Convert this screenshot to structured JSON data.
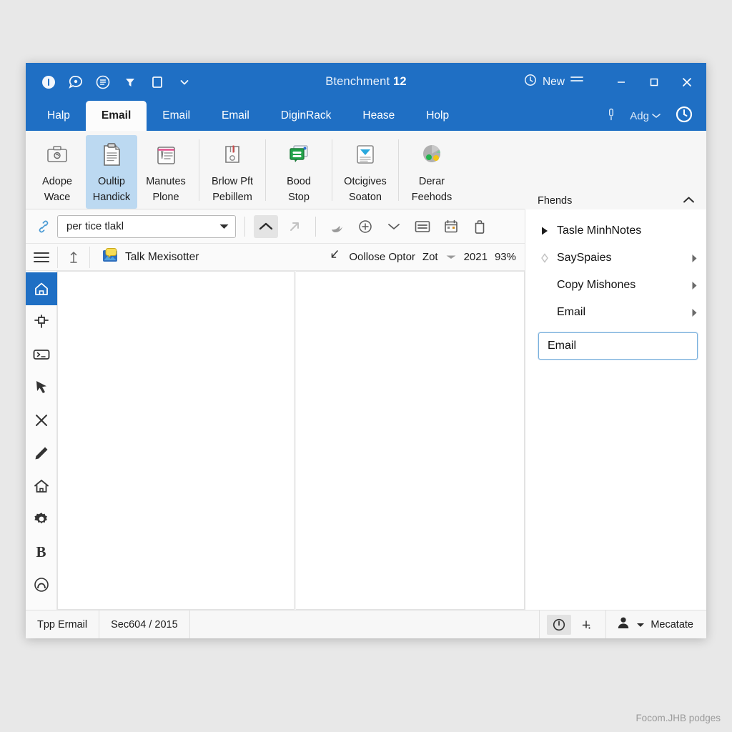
{
  "titlebar": {
    "quick_access": [
      "info-circle-icon",
      "chat-bubble-icon",
      "document-circle-icon",
      "funnel-icon",
      "square-icon",
      "chevron-down-icon"
    ],
    "title_prefix": "Btenchment ",
    "title_number": "12",
    "new_label": "New",
    "minimize_label": "—",
    "maximize_label": "☐",
    "close_label": "✕"
  },
  "tabs": [
    {
      "label": "Halp",
      "active": false
    },
    {
      "label": "Email",
      "active": true
    },
    {
      "label": "Email",
      "active": false
    },
    {
      "label": "Email",
      "active": false
    },
    {
      "label": "DiginRack",
      "active": false
    },
    {
      "label": "Hease",
      "active": false
    },
    {
      "label": "Holp",
      "active": false
    }
  ],
  "tabbar_right": {
    "account_label": "Adg"
  },
  "ribbon": {
    "buttons": [
      {
        "label": "Adope\nWace",
        "icon": "briefcase-icon",
        "selected": false
      },
      {
        "label": "Oultip\nHandick",
        "icon": "clipboard-icon",
        "selected": true
      },
      {
        "label": "Manutes\nPlone",
        "icon": "notepad-icon",
        "selected": false
      },
      {
        "label": "Brlow Pft\nPebillem",
        "icon": "pen-note-icon",
        "selected": false
      },
      {
        "label": "Bood\nStop",
        "icon": "window-stack-icon",
        "selected": false
      },
      {
        "label": "Otcigives\nSoaton",
        "icon": "download-doc-icon",
        "selected": false
      },
      {
        "label": "Derar\nFeehods",
        "icon": "pie-chart-icon",
        "selected": false
      }
    ]
  },
  "side_panel_header": {
    "title": "Fhends",
    "collapse_icon": "chevron-up-icon"
  },
  "toolbar": {
    "link_icon": "link-icon",
    "combo_value": "per tice tlakl",
    "combo_placeholder": "per tice tlakl",
    "collapse_button": "chevron-up-icon",
    "icons": [
      "arrow-up-right-icon",
      "bird-send-icon",
      "plus-circle-icon",
      "chevron-down-icon",
      "list-box-icon",
      "calendar-icon",
      "trash-icon"
    ]
  },
  "doc_header": {
    "menu_icon": "hamburger-icon",
    "anchor_icon": "anchor-icon",
    "doc_icon": "chat-image-icon",
    "doc_name": "Talk Mexisotter",
    "expand_icon": "expand-arrow-icon",
    "close_option": "Oollose Optor",
    "zoom_label": "Zot",
    "year": "2021",
    "zoom_percent": "93%"
  },
  "rail": [
    {
      "icon": "home-outline-icon",
      "active": true
    },
    {
      "icon": "pin-icon",
      "active": false
    },
    {
      "icon": "terminal-icon",
      "active": false
    },
    {
      "icon": "cursor-arrow-icon",
      "active": false
    },
    {
      "icon": "close-x-icon",
      "active": false
    },
    {
      "icon": "pencil-icon",
      "active": false
    },
    {
      "icon": "house-icon",
      "active": false
    },
    {
      "icon": "gear-icon",
      "active": false
    },
    {
      "icon": "bold-b-icon",
      "active": false
    },
    {
      "icon": "arc-circle-icon",
      "active": false
    }
  ],
  "right_panel": {
    "items": [
      {
        "label": "Tasle MinhNotes",
        "prefix": "triangle-right-icon",
        "chevron": false
      },
      {
        "label": "SaySpaies",
        "prefix": "diamond-icon",
        "chevron": true
      },
      {
        "label": "Copy Mishones",
        "prefix": "",
        "chevron": true
      },
      {
        "label": "Email",
        "prefix": "",
        "chevron": true
      }
    ],
    "field_value": "Email"
  },
  "statusbar": {
    "cells": [
      "Tpp Ermail",
      "Sec604 / 2015"
    ],
    "power_icon": "power-icon",
    "add_icon": "plus-small-icon",
    "user_icon": "person-icon",
    "user_dropdown": "caret-down-icon",
    "user_name": "Mecatate"
  },
  "watermark": "Focom.JHB podges"
}
